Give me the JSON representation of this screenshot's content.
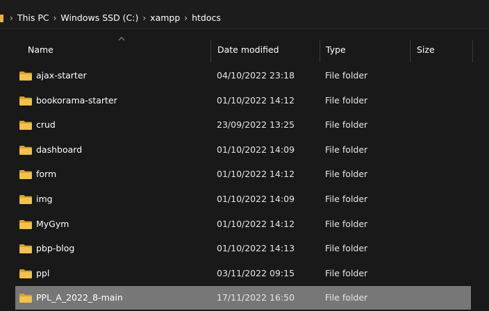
{
  "breadcrumb": {
    "items": [
      "This PC",
      "Windows SSD (C:)",
      "xampp",
      "htdocs"
    ],
    "separator": "›"
  },
  "columns": {
    "name": "Name",
    "date": "Date modified",
    "type": "Type",
    "size": "Size"
  },
  "rows": [
    {
      "name": "ajax-starter",
      "date": "04/10/2022 23:18",
      "type": "File folder",
      "selected": false
    },
    {
      "name": "bookorama-starter",
      "date": "01/10/2022 14:12",
      "type": "File folder",
      "selected": false
    },
    {
      "name": "crud",
      "date": "23/09/2022 13:25",
      "type": "File folder",
      "selected": false
    },
    {
      "name": "dashboard",
      "date": "01/10/2022 14:09",
      "type": "File folder",
      "selected": false
    },
    {
      "name": "form",
      "date": "01/10/2022 14:12",
      "type": "File folder",
      "selected": false
    },
    {
      "name": "img",
      "date": "01/10/2022 14:09",
      "type": "File folder",
      "selected": false
    },
    {
      "name": "MyGym",
      "date": "01/10/2022 14:12",
      "type": "File folder",
      "selected": false
    },
    {
      "name": "pbp-blog",
      "date": "01/10/2022 14:13",
      "type": "File folder",
      "selected": false
    },
    {
      "name": "ppl",
      "date": "03/11/2022 09:15",
      "type": "File folder",
      "selected": false
    },
    {
      "name": "PPL_A_2022_8-main",
      "date": "17/11/2022 16:50",
      "type": "File folder",
      "selected": true
    }
  ],
  "colors": {
    "background": "#191919",
    "selected_row": "#777777",
    "folder": "#f2c14e",
    "folder_dark": "#d9a32c"
  },
  "icons": {
    "folder": "folder-icon",
    "sort": "sort-ascending-icon",
    "chevron": "chevron-right-icon"
  }
}
